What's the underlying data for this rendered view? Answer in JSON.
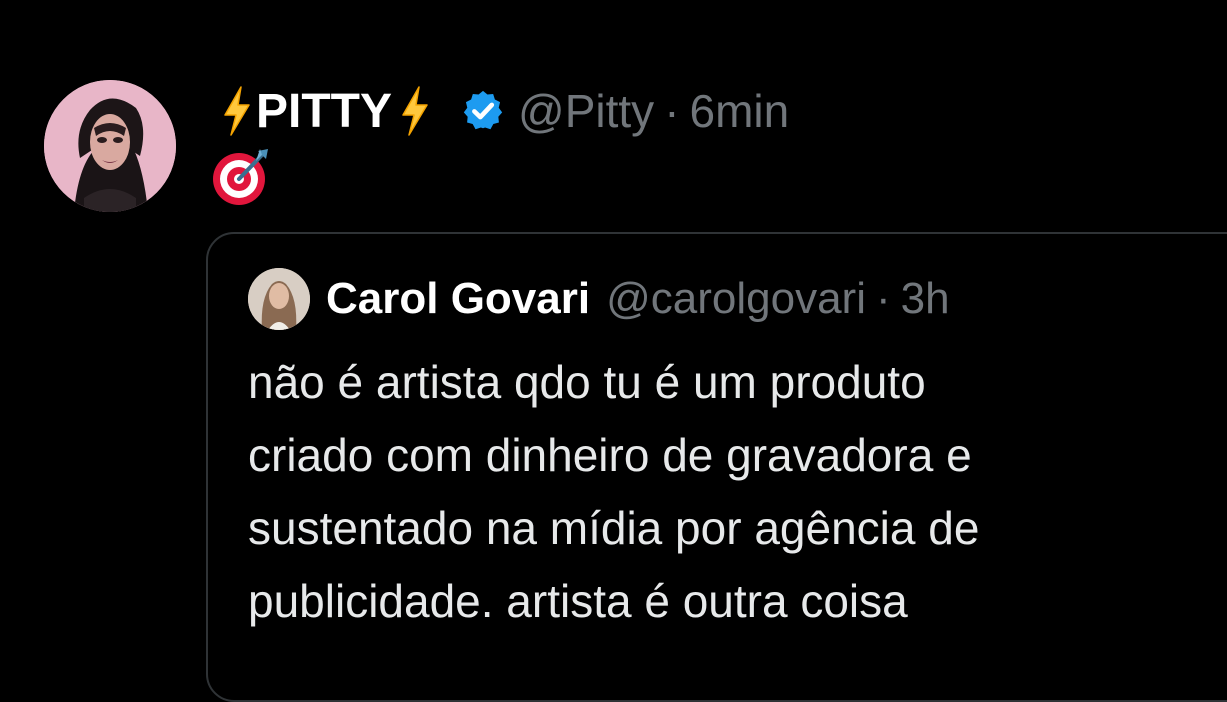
{
  "tweet": {
    "display_name_prefix_icon": "lightning-bolt-icon",
    "display_name": "PITTY",
    "display_name_suffix_icon": "lightning-bolt-icon",
    "verified_icon": "verified-badge-icon",
    "handle": "@Pitty",
    "separator": "·",
    "time": "6min",
    "body_icon": "direct-hit-target-icon"
  },
  "quote": {
    "display_name": "Carol Govari",
    "handle": "@carolgovari",
    "separator": "·",
    "time": "3h",
    "text_lines": [
      "não é artista qdo tu é um produto",
      "criado com dinheiro de gravadora e",
      "sustentado na mídia por agência de",
      "publicidade. artista é outra coisa"
    ]
  },
  "colors": {
    "background": "#000000",
    "primary_text": "#e7e9ea",
    "secondary_text": "#71767b",
    "border": "#2f3336",
    "verified": "#1d9bf0",
    "bolt": "#ffc83d"
  }
}
